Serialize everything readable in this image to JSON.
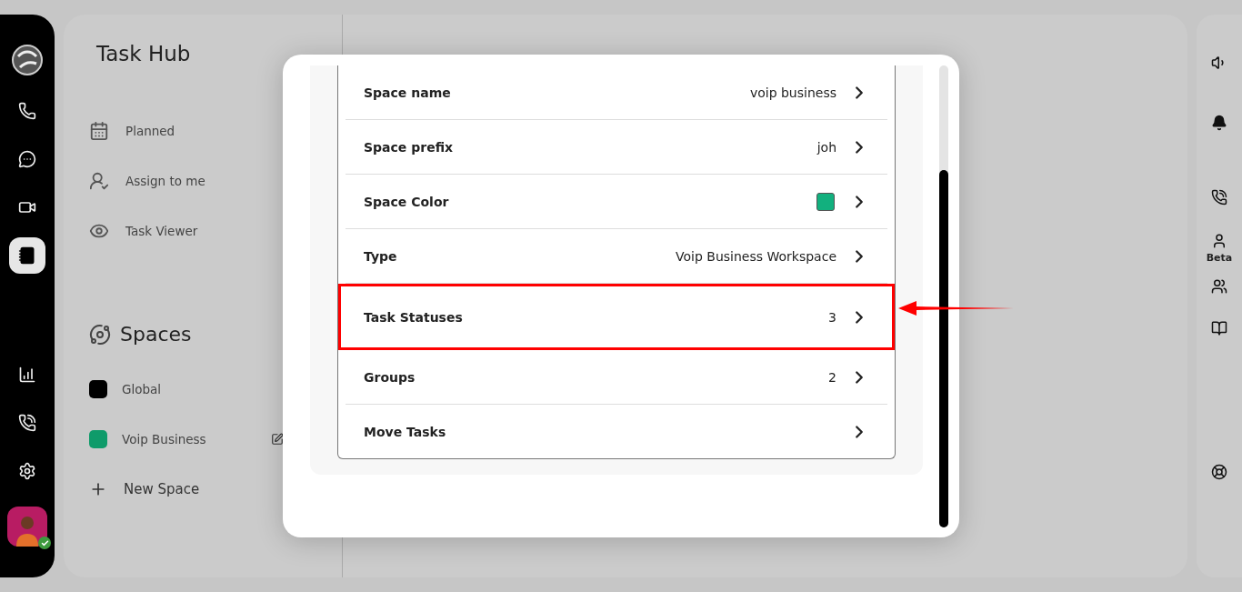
{
  "rail": {
    "items": [
      {
        "selected": false
      },
      {
        "selected": false
      },
      {
        "selected": false
      },
      {
        "selected": true
      }
    ],
    "bottom": [
      {
        "selected": false
      },
      {
        "selected": false
      },
      {
        "selected": false
      }
    ],
    "avatar": {
      "online": true
    }
  },
  "task_hub": {
    "title": "Task Hub",
    "items": [
      {
        "label": "Planned"
      },
      {
        "label": "Assign to me"
      },
      {
        "label": "Task Viewer"
      }
    ]
  },
  "spaces": {
    "title": "Spaces",
    "items": [
      {
        "name": "Global",
        "color": "#000000",
        "editable": false
      },
      {
        "name": "Voip Business",
        "color": "#0f9b6a",
        "editable": true
      }
    ],
    "new_space": "New Space"
  },
  "dialog": {
    "rows": [
      {
        "kind": "text",
        "label": "Space name",
        "value": "voip business",
        "highlighted": false
      },
      {
        "kind": "text",
        "label": "Space prefix",
        "value": "joh",
        "highlighted": false
      },
      {
        "kind": "color",
        "label": "Space Color",
        "color": "#12b07e",
        "highlighted": false
      },
      {
        "kind": "text",
        "label": "Type",
        "value": "Voip Business Workspace",
        "highlighted": false
      },
      {
        "kind": "text",
        "label": "Task Statuses",
        "value": "3",
        "highlighted": true
      },
      {
        "kind": "text",
        "label": "Groups",
        "value": "2",
        "highlighted": false
      },
      {
        "kind": "text",
        "label": "Move Tasks",
        "highlighted": false
      }
    ]
  },
  "right_rail": {
    "items": [
      {
        "kind": "sound"
      },
      {
        "kind": "bell"
      },
      {
        "kind": "call-star"
      },
      {
        "kind": "user",
        "label": "Beta"
      },
      {
        "kind": "users"
      },
      {
        "kind": "book"
      },
      {
        "kind": "help"
      }
    ]
  }
}
